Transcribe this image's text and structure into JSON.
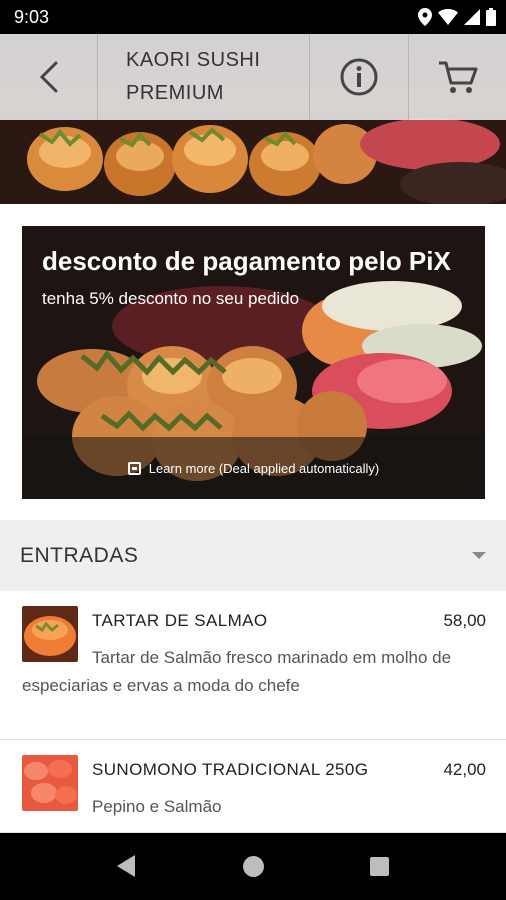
{
  "status_bar": {
    "time": "9:03"
  },
  "header": {
    "title": "KAORI SUSHI\nPREMIUM",
    "icons": {
      "back": "back-arrow-icon",
      "info": "info-icon",
      "cart": "cart-icon"
    }
  },
  "promo": {
    "title": "desconto de pagamento pelo PiX",
    "subtitle": "tenha 5% desconto no seu pedido",
    "footer": "Learn more (Deal applied automatically)"
  },
  "section": {
    "title": "ENTRADAS"
  },
  "items": [
    {
      "name": "TARTAR DE SALMAO",
      "price": "58,00",
      "description": "Tartar de Salmão fresco marinado em molho de especiarias e ervas a moda do chefe"
    },
    {
      "name": "SUNOMONO TRADICIONAL 250G",
      "price": "42,00",
      "description": "Pepino e Salmão"
    }
  ],
  "colors": {
    "header_bg": "#ececec",
    "status_bar": "#000000",
    "section_bg": "#efefef",
    "text_dark": "#222222"
  }
}
